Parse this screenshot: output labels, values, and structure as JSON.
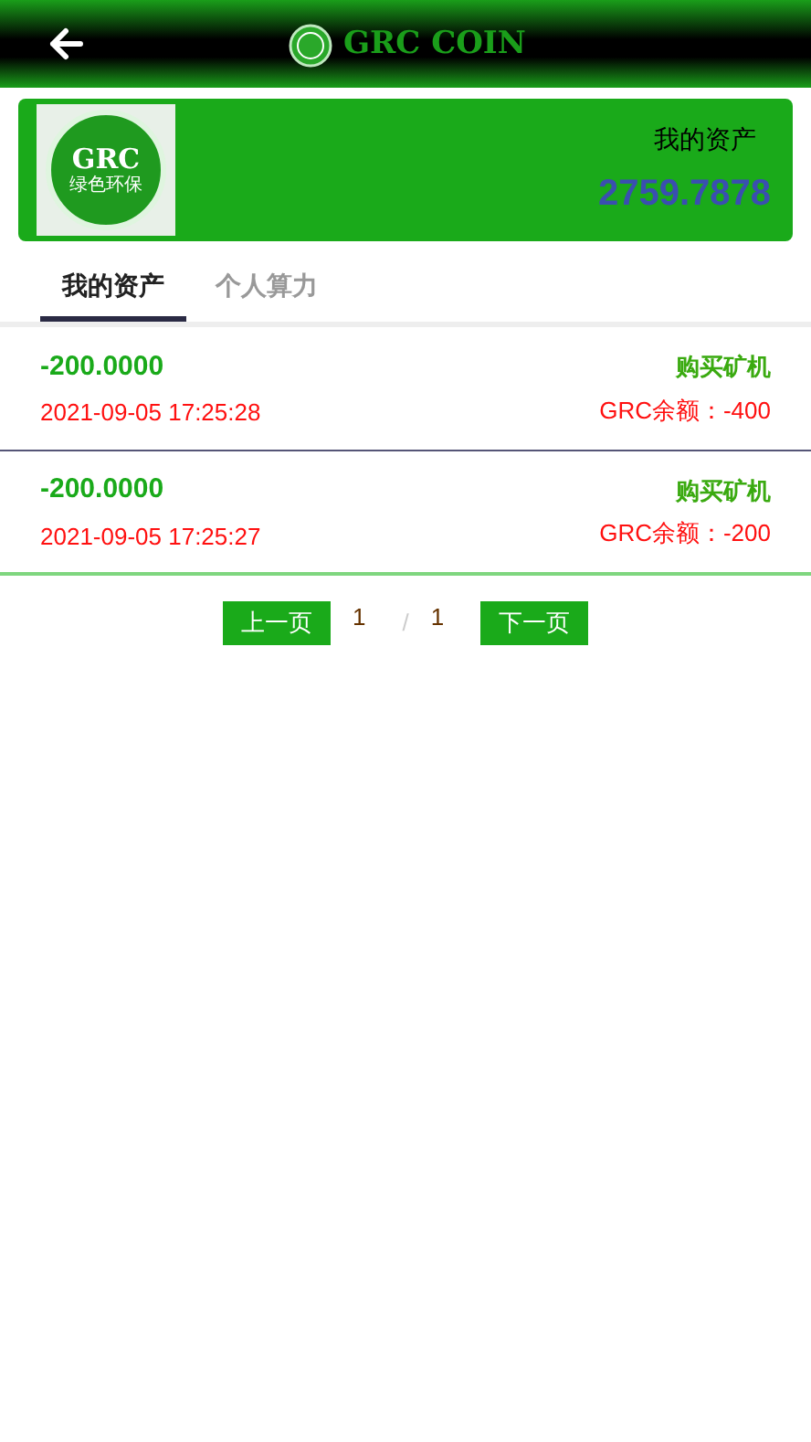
{
  "header": {
    "title": "GRC COIN"
  },
  "asset_card": {
    "logo_text": "GRC",
    "logo_subtext": "绿色环保",
    "label": "我的资产",
    "amount": "2759.7878"
  },
  "tabs": [
    {
      "label": "我的资产",
      "selected": true
    },
    {
      "label": "个人算力",
      "selected": false
    }
  ],
  "records": [
    {
      "amount": "-200.0000",
      "time": "2021-09-05 17:25:28",
      "type": "购买矿机",
      "balance": "GRC余额：-400"
    },
    {
      "amount": "-200.0000",
      "time": "2021-09-05 17:25:27",
      "type": "购买矿机",
      "balance": "GRC余额：-200"
    }
  ],
  "pagination": {
    "prev": "上一页",
    "current": "1",
    "separator": "/",
    "total": "1",
    "next": "下一页"
  }
}
